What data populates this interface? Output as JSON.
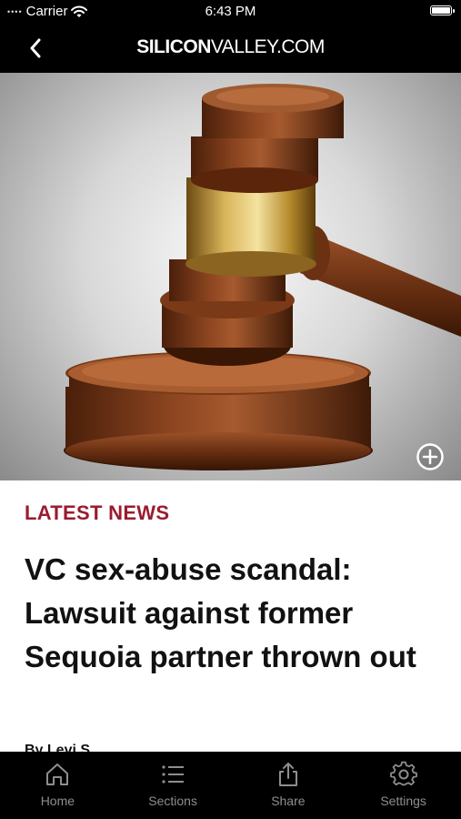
{
  "status_bar": {
    "carrier": "Carrier",
    "time": "6:43 PM",
    "signal_dots": "••••"
  },
  "nav": {
    "logo_bold": "SILICON",
    "logo_rest": "VALLEY.COM"
  },
  "hero": {
    "image": "gavel-photo",
    "expand_icon": "plus-circle-icon"
  },
  "article": {
    "section": "LATEST NEWS",
    "headline": "VC sex-abuse scandal: Lawsuit against former Sequoia partner thrown out",
    "byline_partial": "By Levi S"
  },
  "tab_bar": {
    "items": [
      {
        "label": "Home",
        "icon": "home-icon"
      },
      {
        "label": "Sections",
        "icon": "list-icon"
      },
      {
        "label": "Share",
        "icon": "share-icon"
      },
      {
        "label": "Settings",
        "icon": "gear-icon"
      }
    ]
  },
  "colors": {
    "accent": "#9b1b2e",
    "bars": "#000000",
    "tab_label": "#8e8e8e"
  }
}
